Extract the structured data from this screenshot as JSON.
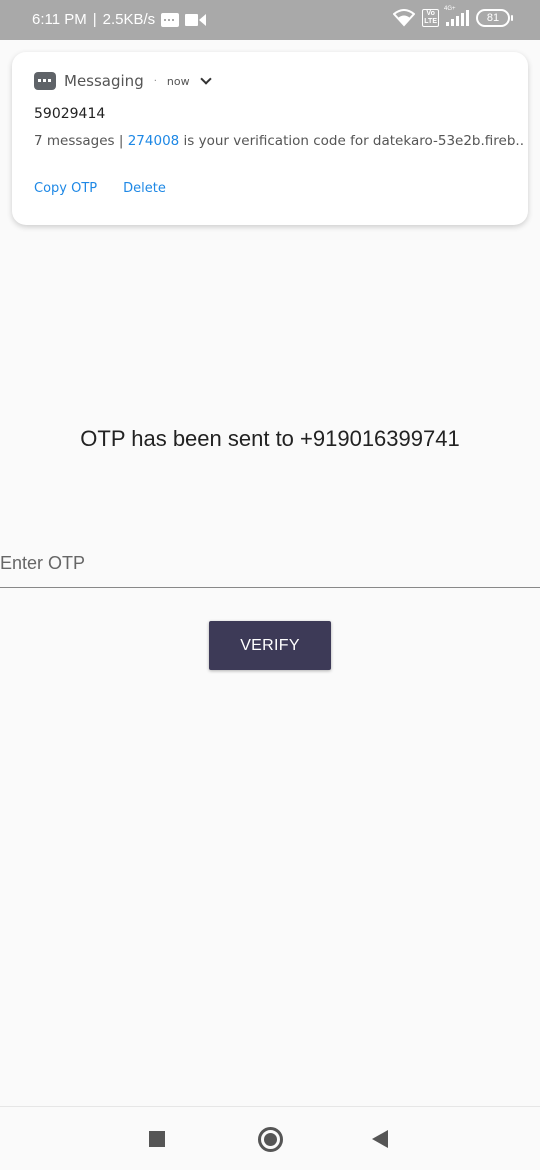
{
  "status_bar": {
    "time": "6:11 PM",
    "separator": "|",
    "network_speed": "2.5KB/s",
    "volte_label": "Vo\nLTE",
    "network_type": "4G+",
    "battery": "81",
    "icons": [
      "message-icon",
      "video-icon",
      "wifi-icon",
      "volte-icon",
      "signal-icon",
      "battery-icon"
    ]
  },
  "notification": {
    "app_name": "Messaging",
    "dot": "·",
    "time": "now",
    "title": "59029414",
    "body_prefix": "7 messages | ",
    "body_code": "274008",
    "body_suffix": " is your verification code for datekaro-53e2b.fireb..",
    "actions": {
      "copy": "Copy OTP",
      "delete": "Delete"
    },
    "accent_color": "#1e88e5"
  },
  "main": {
    "otp_message": "OTP has been sent to +919016399741",
    "otp_input": {
      "placeholder": "Enter OTP",
      "value": ""
    },
    "verify_button": "VERIFY",
    "button_color": "#3d3a57"
  },
  "nav_bar": {
    "icons": [
      "recents-square-icon",
      "home-circle-icon",
      "back-triangle-icon"
    ]
  }
}
